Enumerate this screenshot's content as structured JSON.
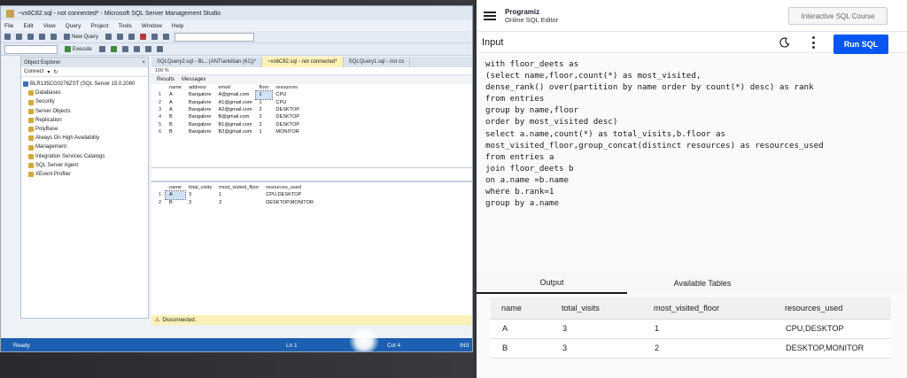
{
  "ssms": {
    "title": "~vs6C82.sql - not connected* - Microsoft SQL Server Management Studio",
    "menu": [
      "File",
      "Edit",
      "View",
      "Query",
      "Project",
      "Tools",
      "Window",
      "Help"
    ],
    "toolbar": {
      "new_query": "New Query",
      "execute": "Execute"
    },
    "object_explorer": {
      "title": "Object Explorer",
      "connect": "Connect",
      "server": "BLR135CG0276ZST (SQL Server 15.0.2080",
      "nodes": [
        "Databases",
        "Security",
        "Server Objects",
        "Replication",
        "PolyBase",
        "Always On High Availability",
        "Management",
        "Integration Services Catalogs",
        "SQL Server Agent",
        "XEvent Profiler"
      ]
    },
    "tabs": [
      "SQLQuery2.sql - BL...(ANT\\ankiban (61))*",
      "~vs6C82.sql - not connected*",
      "SQLQuery1.sql - not co"
    ],
    "zoom": "100 %",
    "results_tab": "Results",
    "messages_tab": "Messages",
    "grid1": {
      "columns": [
        "name",
        "address",
        "email",
        "floor",
        "resources"
      ],
      "rows": [
        [
          "1",
          "A",
          "Bangalore",
          "A@gmail.com",
          "1",
          "CPU"
        ],
        [
          "2",
          "A",
          "Bangalore",
          "A1@gmail.com",
          "1",
          "CPU"
        ],
        [
          "3",
          "A",
          "Bangalore",
          "A2@gmail.com",
          "2",
          "DESKTOP"
        ],
        [
          "4",
          "B",
          "Bangalore",
          "B@gmail.com",
          "2",
          "DESKTOP"
        ],
        [
          "5",
          "B",
          "Bangalore",
          "B1@gmail.com",
          "2",
          "DESKTOP"
        ],
        [
          "6",
          "B",
          "Bangalore",
          "B2@gmail.com",
          "1",
          "MONITOR"
        ]
      ]
    },
    "grid2": {
      "columns": [
        "name",
        "total_visits",
        "most_visited_floor",
        "resources_used"
      ],
      "rows": [
        [
          "1",
          "A",
          "3",
          "1",
          "CPU,DESKTOP"
        ],
        [
          "2",
          "B",
          "3",
          "2",
          "DESKTOP,MONITOR"
        ]
      ]
    },
    "status_disconnected": "Disconnected.",
    "status_ready": "Ready",
    "status_ln": "Ln 1",
    "status_col": "Col 4",
    "status_ins": "INS"
  },
  "programiz": {
    "brand": "Programiz",
    "subtitle": "Online SQL Editor",
    "course_button": "Interactive SQL Course",
    "input_label": "Input",
    "run_button": "Run SQL",
    "code_lines": [
      "with floor_deets as",
      "(select name,floor,count(*) as most_visited,",
      "dense_rank() over(partition by name order by count(*) desc) as rank",
      "from entries",
      "group by name,floor",
      "order by most_visited desc)",
      "select a.name,count(*) as total_visits,b.floor as",
      "most_visited_floor,group_concat(distinct resources) as resources_used",
      "from entries a",
      "join floor_deets b",
      "on a.name =b.name",
      "where b.rank=1",
      "group by a.name"
    ],
    "output_tab": "Output",
    "tables_tab": "Available Tables",
    "result": {
      "columns": [
        "name",
        "total_visits",
        "most_visited_floor",
        "resources_used"
      ],
      "rows": [
        [
          "A",
          "3",
          "1",
          "CPU,DESKTOP"
        ],
        [
          "B",
          "3",
          "2",
          "DESKTOP,MONITOR"
        ]
      ]
    }
  }
}
